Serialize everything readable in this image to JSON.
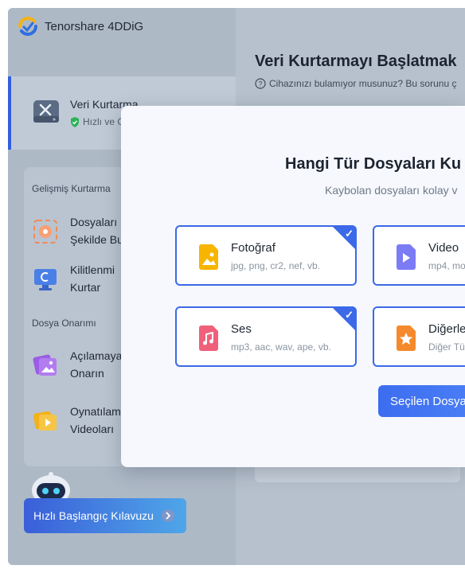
{
  "app": {
    "title": "Tenorshare 4DDiG"
  },
  "sidebar": {
    "active_item": {
      "title": "Veri Kurtarma",
      "subtitle": "Hızlı ve Güvenli"
    },
    "section_advanced": "Gelişmiş Kurtarma",
    "advanced_items": [
      {
        "label_line1": "Dosyaları",
        "label_line2": "Şekilde Bul",
        "icon": "target-icon"
      },
      {
        "label_line1": "Kilitlenmi",
        "label_line2": "Kurtar",
        "icon": "monitor-icon"
      }
    ],
    "section_repair": "Dosya Onarımı",
    "repair_items": [
      {
        "label_line1": "Açılamaya",
        "label_line2": "Onarın",
        "icon": "photo-repair-icon"
      },
      {
        "label_line1": "Oynatılam",
        "label_line2": "Videoları",
        "icon": "video-repair-icon"
      }
    ],
    "guide_button": "Hızlı Başlangıç Kılavuzu"
  },
  "main": {
    "title": "Veri Kurtarmayı Başlatmak",
    "help": "Cihazınızı bulamıyor musunuz? Bu sorunu ç"
  },
  "modal": {
    "title": "Hangi Tür Dosyaları Ku",
    "subtitle": "Kaybolan dosyaları kolay v",
    "options": [
      {
        "name": "Fotoğraf",
        "desc": "jpg, png, cr2, nef, vb.",
        "checked": true,
        "color": "#f7b500"
      },
      {
        "name": "Video",
        "desc": "mp4, mo",
        "checked": false,
        "color": "#7b7cf5"
      },
      {
        "name": "Ses",
        "desc": "mp3, aac, wav, ape, vb.",
        "checked": true,
        "color": "#f0607a"
      },
      {
        "name": "Diğerle",
        "desc": "Diğer Tü",
        "checked": false,
        "color": "#f58a2c"
      }
    ],
    "start_button": "Seçilen Dosya"
  }
}
